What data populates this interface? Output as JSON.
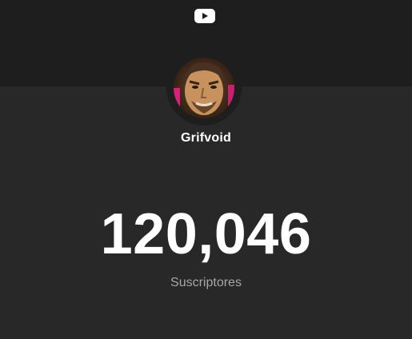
{
  "channel": {
    "name": "Grifvoid",
    "avatar_icon": "channel-avatar"
  },
  "header": {
    "logo_icon": "youtube-logo-icon"
  },
  "stats": {
    "subscriber_count": "120,046",
    "label": "Suscriptores"
  },
  "colors": {
    "background": "#282828",
    "top_band": "#1e1e1e",
    "text": "#ffffff",
    "muted_text": "#a7a7a7"
  }
}
